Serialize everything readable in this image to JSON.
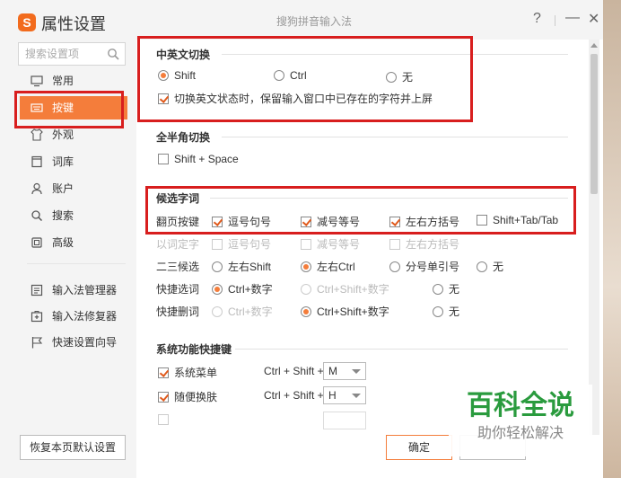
{
  "titlebar": {
    "app_title": "属性设置",
    "window_title": "搜狗拼音输入法",
    "help": "?",
    "minimize": "—",
    "close": "✕"
  },
  "sidebar": {
    "search_placeholder": "搜索设置项",
    "items": [
      {
        "label": "常用",
        "icon": "monitor-icon"
      },
      {
        "label": "按键",
        "icon": "keyboard-icon",
        "active": true
      },
      {
        "label": "外观",
        "icon": "shirt-icon"
      },
      {
        "label": "词库",
        "icon": "book-icon"
      },
      {
        "label": "账户",
        "icon": "user-icon"
      },
      {
        "label": "搜索",
        "icon": "search-icon"
      },
      {
        "label": "高级",
        "icon": "square-icon"
      }
    ],
    "tools": [
      {
        "label": "输入法管理器",
        "icon": "manager-icon"
      },
      {
        "label": "输入法修复器",
        "icon": "repair-icon"
      },
      {
        "label": "快速设置向导",
        "icon": "flag-icon"
      }
    ],
    "reset_button": "恢复本页默认设置"
  },
  "sections": {
    "zh_en_switch": {
      "title": "中英文切换",
      "options": [
        "Shift",
        "Ctrl",
        "无"
      ],
      "selected": "Shift",
      "keep_checkbox": "切换英文状态时，保留输入窗口中已存在的字符并上屏"
    },
    "full_half": {
      "title": "全半角切换",
      "checkbox": "Shift + Space"
    },
    "candidates": {
      "title": "候选字词",
      "page_keys_label": "翻页按键",
      "page_keys": [
        "逗号句号",
        "减号等号",
        "左右方括号",
        "Shift+Tab/Tab"
      ],
      "fix_label": "以词定字",
      "fix_keys": [
        "逗号句号",
        "减号等号",
        "左右方括号"
      ],
      "second_third_label": "二三候选",
      "second_third": [
        "左右Shift",
        "左右Ctrl",
        "分号单引号",
        "无"
      ],
      "quick_select_label": "快捷选词",
      "quick_select": [
        "Ctrl+数字",
        "Ctrl+Shift+数字",
        "无"
      ],
      "quick_delete_label": "快捷删词",
      "quick_delete": [
        "Ctrl+数字",
        "Ctrl+Shift+数字",
        "无"
      ]
    },
    "shortcuts": {
      "title": "系统功能快捷键",
      "rows": [
        {
          "label": "系统菜单",
          "keys": "Ctrl + Shift +",
          "value": "M"
        },
        {
          "label": "随便换肤",
          "keys": "Ctrl + Shift +",
          "value": "H"
        }
      ]
    }
  },
  "footer": {
    "ok": "确定"
  },
  "watermark": {
    "line1": "百科全说",
    "line2": "助你轻松解决"
  }
}
